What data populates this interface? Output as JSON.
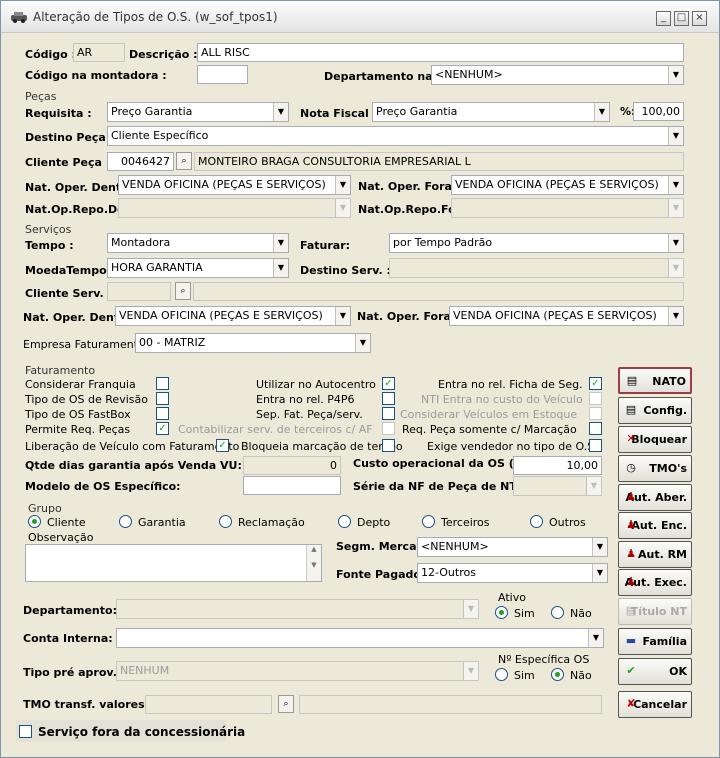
{
  "window": {
    "title": "Alteração de Tipos de O.S. (w_sof_tpos1)",
    "min": "_",
    "max": "□",
    "close": "×"
  },
  "top": {
    "codigo_label": "Código :",
    "codigo": "AR",
    "descricao_label": "Descrição :",
    "descricao": "ALL RISC",
    "montadora_label": "Código na montadora :",
    "montadora": "",
    "depto_nf_label": "Departamento na NF:",
    "depto_nf": "<NENHUM>"
  },
  "pecas": {
    "title": "Peças",
    "requisita_label": "Requisita :",
    "requisita": "Preço Garantia",
    "nota_label": "Nota Fiscal :",
    "nota": "Preço Garantia",
    "pct_label": "%:",
    "pct": "100,00",
    "destino_label": "Destino Peça :",
    "destino": "Cliente Específico",
    "cliente_label": "Cliente Peça :",
    "cliente_cod": "0046427",
    "cliente_nome": "MONTEIRO BRAGA CONSULTORIA EMPRESARIAL L",
    "nat_dentro_label": "Nat. Oper. Dentro:",
    "nat_dentro": "VENDA OFICINA (PEÇAS E SERVIÇOS)",
    "nat_fora_label": "Nat. Oper. Fora:",
    "nat_fora": "VENDA OFICINA (PEÇAS E SERVIÇOS)",
    "repo_den_label": "Nat.Op.Repo.Den:",
    "repo_fora_label": "Nat.Op.Repo.Fora:"
  },
  "servicos": {
    "title": "Serviços",
    "tempo_label": "Tempo :",
    "tempo": "Montadora",
    "faturar_label": "Faturar:",
    "faturar": "por Tempo Padrão",
    "moeda_label": "MoedaTempo :",
    "moeda": "HORA GARANTIA",
    "destino_label": "Destino Serv. :",
    "cliente_label": "Cliente Serv. :",
    "nat_dentro_label": "Nat. Oper. Dentro:",
    "nat_dentro": "VENDA OFICINA (PEÇAS E SERVIÇOS)",
    "nat_fora_label": "Nat. Oper. Fora:",
    "nat_fora": "VENDA OFICINA (PEÇAS E SERVIÇOS)",
    "empresa_label": "Empresa Faturamento:",
    "empresa": "00 - MATRIZ"
  },
  "fat": {
    "title": "Faturamento",
    "considerar": "Considerar Franquia",
    "revisao": "Tipo de OS de Revisão",
    "fastbox": "Tipo de OS FastBox",
    "permite": "Permite Req. Peças",
    "liberacao": "Liberação de Veículo com Faturamento",
    "autocentro": "Utilizar no Autocentro",
    "p4p6": "Entra no rel. P4P6",
    "sepfat": "Sep. Fat. Peça/serv.",
    "contabilizar": "Contabilizar serv. de terceiros c/ AF",
    "bloqueia": "Bloqueia marcação de tempo",
    "ficha": "Entra no rel. Ficha de Seg.",
    "nti": "NTI Entra no custo do Veículo",
    "estoque": "Considerar Veículos em Estoque",
    "reqpeca": "Req. Peça somente c/ Marcação",
    "exige": "Exige vendedor no tipo de O.S.",
    "qtde_label": "Qtde dias garantia após Venda VU:",
    "qtde": "0",
    "custo_label": "Custo operacional da OS (%)",
    "custo": "10,00",
    "modelo_label": "Modelo de OS Específico:",
    "serie_label": "Série da NF de Peça de NTI"
  },
  "grupo": {
    "title": "Grupo",
    "opts": [
      "Cliente",
      "Garantia",
      "Reclamação",
      "Depto",
      "Terceiros",
      "Outros"
    ]
  },
  "obs": {
    "label": "Observação",
    "segm_label": "Segm. Mercado:",
    "segm": "<NENHUM>",
    "fonte_label": "Fonte Pagadora:",
    "fonte": "12-Outros"
  },
  "bottom": {
    "depto_label": "Departamento:",
    "ativo_label": "Ativo",
    "sim": "Sim",
    "nao": "Não",
    "conta_label": "Conta Interna:",
    "tipo_label": "Tipo pré aprov.:",
    "tipo": "NENHUM",
    "nesp_label": "Nº Específica OS",
    "tmo_label": "TMO transf. valores:",
    "fora_label": "Serviço fora da concessionária"
  },
  "buttons": {
    "nato": "NATO",
    "config": "Config.",
    "bloquear": "Bloquear",
    "tmos": "TMO's",
    "aut_aber": "Aut. Aber.",
    "aut_enc": "Aut. Enc.",
    "aut_rm": "Aut. RM",
    "aut_exec": "Aut. Exec.",
    "titulo": "Título NT",
    "familia": "Família",
    "ok": "OK",
    "cancelar": "Cancelar"
  },
  "colors": {
    "check": "#21a121",
    "border": "#1c5180"
  }
}
